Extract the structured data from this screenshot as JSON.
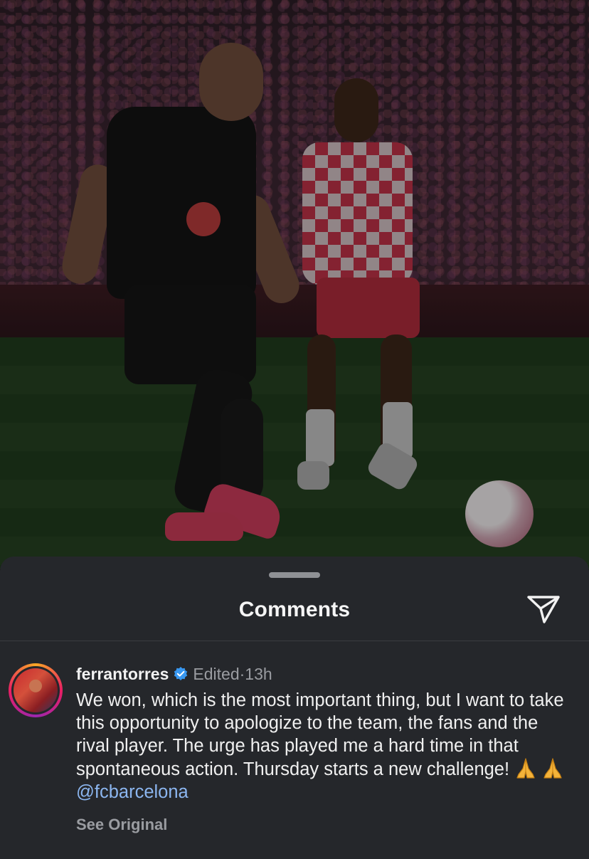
{
  "sheet": {
    "title": "Comments",
    "share_icon": "send-paper-plane-icon"
  },
  "comment": {
    "username": "ferrantorres",
    "verified_icon": "verified-badge-icon",
    "edited_label": "Edited",
    "separator": " · ",
    "time": "13h",
    "text": "We won, which is the most important thing, but I want to take this opportunity to apologize to the team, the fans and the rival player. The urge has played me a hard time in that spontaneous action. Thursday starts a new challenge!",
    "emojis": [
      "praying-hands-icon",
      "praying-hands-icon"
    ],
    "mention": "@fcbarcelona",
    "see_original": "See Original"
  },
  "colors": {
    "sheet_bg": "#25272b",
    "mention": "#8cb6f0",
    "verified": "#3897f0",
    "muted_text": "#9a9ca1"
  }
}
